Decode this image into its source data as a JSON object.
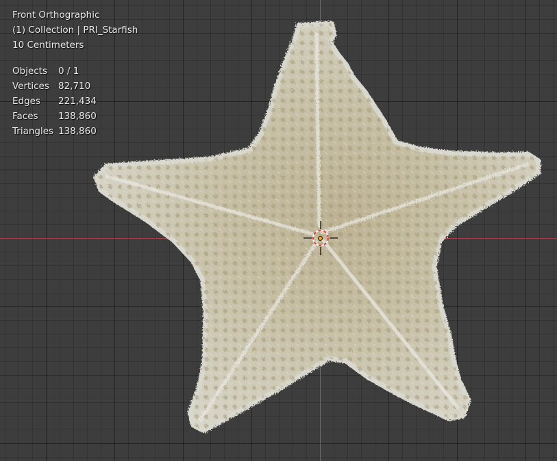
{
  "viewport": {
    "view_name": "Front Orthographic",
    "collection": "(1) Collection | PRI_Starfish",
    "scale": "10 Centimeters"
  },
  "stats": [
    {
      "label": "Objects",
      "value": "0 / 1"
    },
    {
      "label": "Vertices",
      "value": "82,710"
    },
    {
      "label": "Edges",
      "value": "221,434"
    },
    {
      "label": "Faces",
      "value": "138,860"
    },
    {
      "label": "Triangles",
      "value": "138,860"
    }
  ],
  "colors": {
    "background": "#3d3d3d",
    "axis_x": "#a7404a",
    "axis_z": "#4f6ea6",
    "starfish": "#c9c3aa",
    "cursor_red": "#e03a30"
  },
  "icons": {
    "cursor": "3d-cursor-icon",
    "origin": "object-origin-icon"
  }
}
